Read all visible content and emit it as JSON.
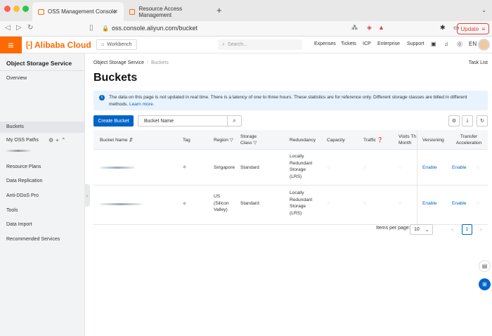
{
  "browser": {
    "tabs": [
      {
        "title": "OSS Management Console",
        "active": true
      },
      {
        "title": "Resource Access Management",
        "active": false
      }
    ],
    "url": "oss.console.aliyun.com/bucket",
    "update_label": "Update"
  },
  "header": {
    "logo": "Alibaba Cloud",
    "workbench": "Workbench",
    "search_placeholder": "Search...",
    "nav": [
      "Expenses",
      "Tickets",
      "ICP",
      "Enterprise",
      "Support"
    ],
    "lang": "EN"
  },
  "sidebar": {
    "title": "Object Storage Service",
    "items": [
      "Overview",
      "Buckets",
      "My OSS Paths",
      "Resource Plans",
      "Data Replication",
      "Anti-DDoS Pro",
      "Tools",
      "Data Import",
      "Recommended Services"
    ],
    "active": "Buckets"
  },
  "breadcrumb": {
    "root": "Object Storage Service",
    "current": "Buckets"
  },
  "task_list": "Task List",
  "page_title": "Buckets",
  "notice": {
    "text": "The data on this page is not updated in real time. There is a latency of one to three hours. These statistics are for reference only. Different storage classes are billed in different methods.",
    "link": "Learn more."
  },
  "toolbar": {
    "create_label": "Create Bucket",
    "filter_label": "Bucket Name"
  },
  "table": {
    "headers": {
      "name": "Bucket Name",
      "tag": "Tag",
      "region": "Region",
      "storage_class": [
        "Storage",
        "Class"
      ],
      "redundancy": "Redundancy",
      "capacity": "Capacity",
      "traffic": "Traffic",
      "visits": [
        "Visits Th",
        "Month"
      ],
      "versioning": "Versioning",
      "transfer": [
        "Transfer",
        "Acceleration"
      ]
    },
    "rows": [
      {
        "region": [
          "Singapore"
        ],
        "storage_class": "Standard",
        "redundancy": [
          "Locally",
          "Redundant",
          "Storage",
          "(LRS)"
        ],
        "versioning": "Enable",
        "transfer": "Enable"
      },
      {
        "region": [
          "US",
          "(Silicon",
          "Valley)"
        ],
        "storage_class": "Standard",
        "redundancy": [
          "Locally",
          "Redundant",
          "Storage",
          "(LRS)"
        ],
        "versioning": "Enable",
        "transfer": "Enable"
      }
    ]
  },
  "pagination": {
    "label": "Items per page:",
    "per_page": "10",
    "current_page": "1"
  },
  "colors": {
    "brand": "#ff6a00",
    "primary": "#0064c8",
    "notice_bg": "#e8f3fe"
  }
}
